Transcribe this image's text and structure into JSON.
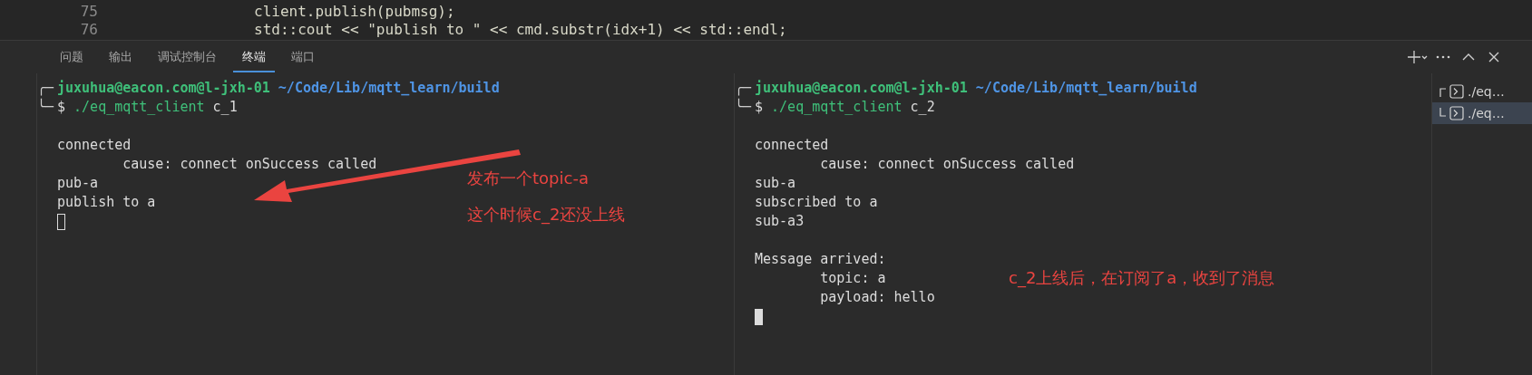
{
  "editor": {
    "lines": [
      {
        "number": "75",
        "code": "client.publish(pubmsg);"
      },
      {
        "number": "76",
        "code": "std::cout << \"publish to \" << cmd.substr(idx+1) << std::endl;"
      }
    ]
  },
  "panel": {
    "tabs": [
      {
        "label": "问题",
        "selected": false
      },
      {
        "label": "输出",
        "selected": false
      },
      {
        "label": "调试控制台",
        "selected": false
      },
      {
        "label": "终端",
        "selected": true
      },
      {
        "label": "端口",
        "selected": false
      }
    ]
  },
  "terminals": [
    {
      "prompt": {
        "corner_top": "╭─",
        "user_host": "juxuhua@eacon.com@l-jxh-01",
        "path": "~/Code/Lib/mqtt_learn/build",
        "corner_bottom": "╰─",
        "symbol": "$",
        "command": "./eq_mqtt_client",
        "argument": "c_1"
      },
      "output": [
        {
          "kind": "line",
          "text": "connected"
        },
        {
          "kind": "line",
          "text": "        cause: connect onSuccess called"
        },
        {
          "kind": "line",
          "text": "pub-a"
        },
        {
          "kind": "line",
          "text": "publish to a"
        }
      ],
      "focused": false,
      "annotations": [
        {
          "text": "发布一个topic-a"
        },
        {
          "text": "这个时候c_2还没上线"
        }
      ],
      "arrow": true
    },
    {
      "prompt": {
        "corner_top": "╭─",
        "user_host": "juxuhua@eacon.com@l-jxh-01",
        "path": "~/Code/Lib/mqtt_learn/build",
        "corner_bottom": "╰─",
        "symbol": "$",
        "command": "./eq_mqtt_client",
        "argument": "c_2"
      },
      "output": [
        {
          "kind": "line",
          "text": "connected"
        },
        {
          "kind": "line",
          "text": "        cause: connect onSuccess called"
        },
        {
          "kind": "line",
          "text": "sub-a"
        },
        {
          "kind": "line",
          "text": "subscribed to a"
        },
        {
          "kind": "line",
          "text": "sub-a3"
        },
        {
          "kind": "blank"
        },
        {
          "kind": "line",
          "text": "Message arrived:"
        },
        {
          "kind": "line",
          "text": "        topic: a"
        },
        {
          "kind": "line",
          "text": "        payload: hello"
        }
      ],
      "focused": true,
      "annotations": [
        {
          "text": "c_2上线后，在订阅了a，收到了消息"
        }
      ],
      "arrow": false
    }
  ],
  "terminal_list": [
    {
      "label": "./eq…",
      "selected": false
    },
    {
      "label": "./eq…",
      "selected": true
    }
  ]
}
